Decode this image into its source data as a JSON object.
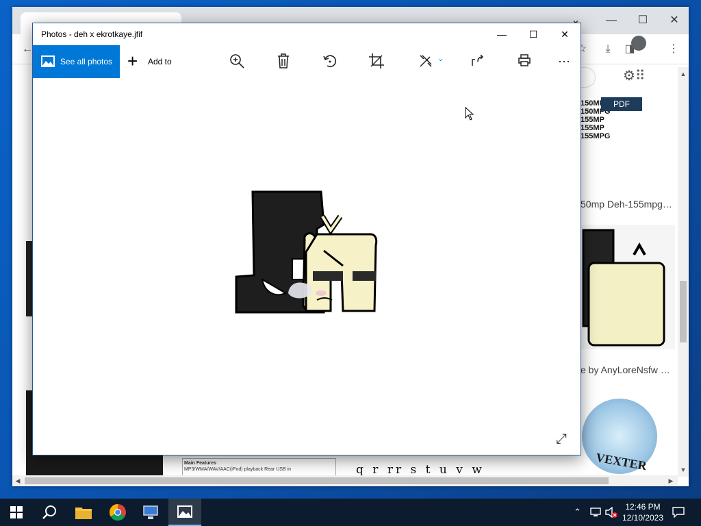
{
  "photos_window": {
    "title": "Photos - deh x ekrotkaye.jfif",
    "minimize_icon": "minimize-icon",
    "maximize_icon": "maximize-icon",
    "close_icon": "close-icon",
    "toolbar": {
      "see_all_label": "See all photos",
      "add_to_label": "Add to",
      "tools": [
        "zoom-in-icon",
        "delete-icon",
        "rotate-icon",
        "crop-icon",
        "edit-icon",
        "share-icon",
        "print-icon",
        "more-icon"
      ]
    },
    "image_name": "deh x ekrotkaye.jfif"
  },
  "browser_background": {
    "captions": {
      "right_top": "50mp Deh-155mpg…",
      "right_middle": "e by AnyLoreNsfw …"
    },
    "pdf_badge": "PDF",
    "specs_lines": [
      "150MP",
      "150MPG",
      "155MP",
      "155MP",
      "155MPG"
    ],
    "box_heading": "Main Features",
    "box_line": "MP3/WMA/WAV/AAC(iPod) playback   Rear USB in",
    "letters": "q r rr s t u v  w",
    "vexter_text": "VEXTER"
  },
  "taskbar": {
    "icons": [
      "start-icon",
      "search-icon",
      "file-explorer-icon",
      "chrome-icon",
      "network-pc-icon",
      "photos-icon"
    ],
    "time": "12:46 PM",
    "date": "12/10/2023"
  },
  "colors": {
    "accent": "#0078d7",
    "taskbar": "#0c1b2e",
    "desktop": "#0a4fa8"
  }
}
